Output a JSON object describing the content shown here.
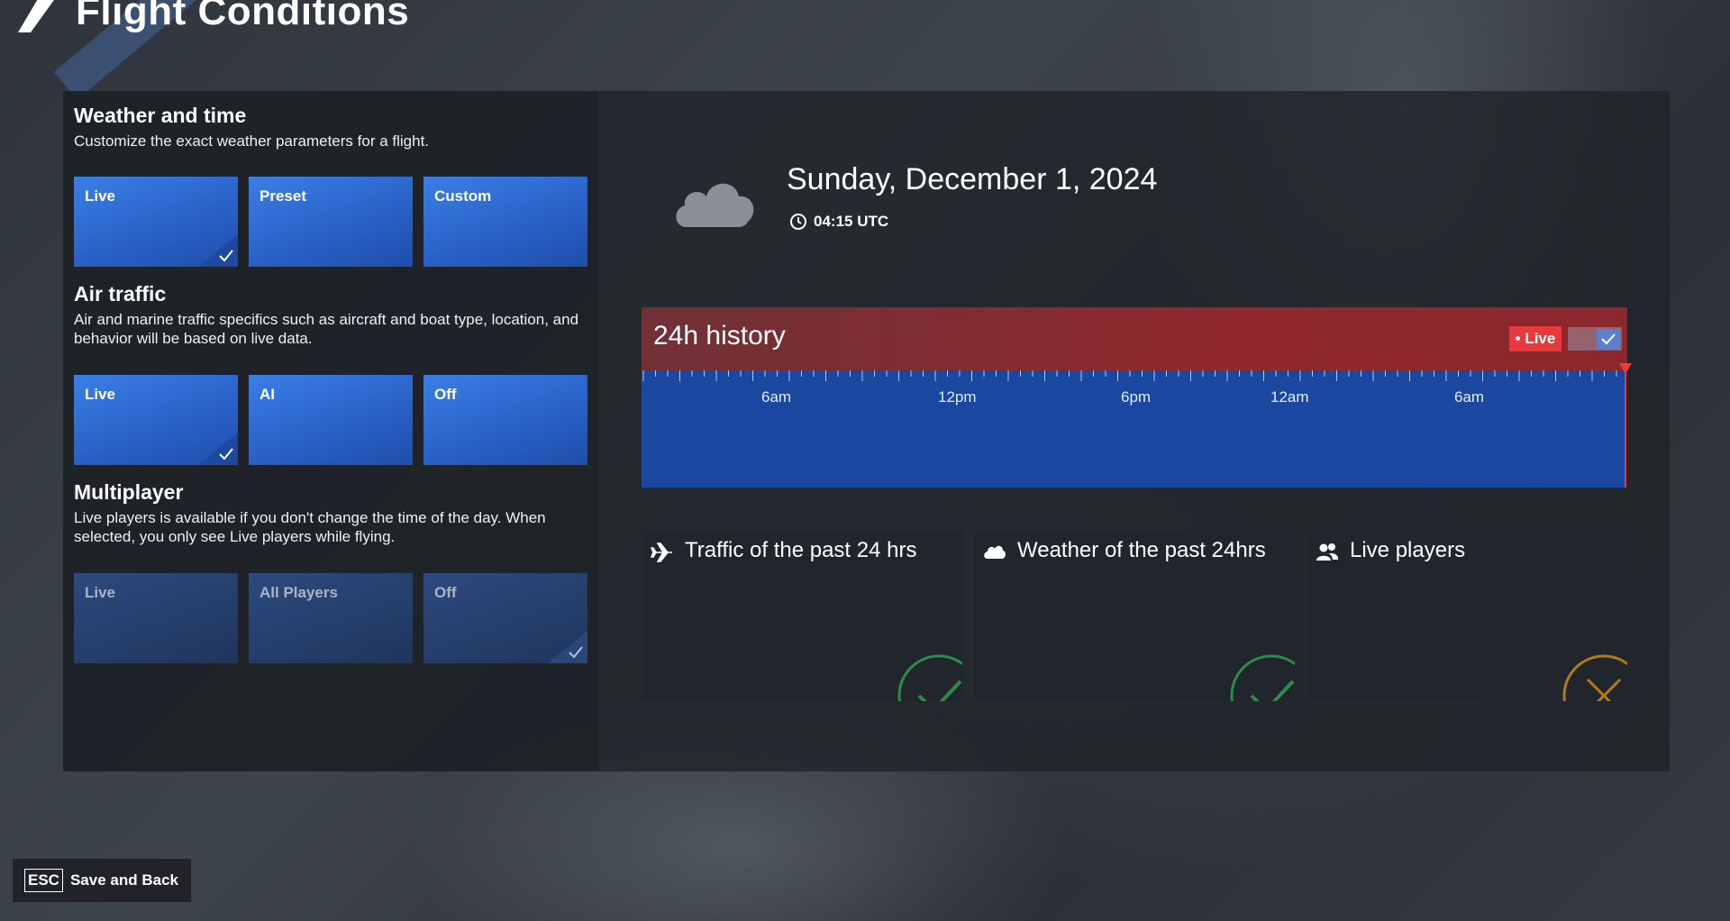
{
  "page": {
    "title": "Flight Conditions"
  },
  "weather_time": {
    "heading": "Weather and time",
    "description": "Customize the exact weather parameters for a flight.",
    "options": [
      {
        "label": "Live",
        "selected": true
      },
      {
        "label": "Preset",
        "selected": false
      },
      {
        "label": "Custom",
        "selected": false
      }
    ]
  },
  "air_traffic": {
    "heading": "Air traffic",
    "description": "Air and marine traffic specifics such as aircraft and boat type, location, and behavior will be based on live data.",
    "options": [
      {
        "label": "Live",
        "selected": true
      },
      {
        "label": "AI",
        "selected": false
      },
      {
        "label": "Off",
        "selected": false
      }
    ]
  },
  "multiplayer": {
    "heading": "Multiplayer",
    "description": "Live players is available if you don't change the time of the day. When selected, you only see Live players while flying.",
    "options": [
      {
        "label": "Live",
        "selected": false
      },
      {
        "label": "All Players",
        "selected": false
      },
      {
        "label": "Off",
        "selected": true
      }
    ]
  },
  "datetime": {
    "date": "Sunday, December 1, 2024",
    "time": "04:15 UTC",
    "weather_icon": "cloud-icon"
  },
  "history": {
    "title": "24h history",
    "live_badge": "• Live",
    "live_toggle_on": true,
    "timeline_labels": [
      "6am",
      "12pm",
      "6pm",
      "12am",
      "6am"
    ]
  },
  "status_cards": [
    {
      "title": "Traffic of the past 24 hrs",
      "icon": "airplane-icon",
      "status": "ok"
    },
    {
      "title": "Weather of the past 24hrs",
      "icon": "cloud-icon",
      "status": "ok"
    },
    {
      "title": "Live players",
      "icon": "players-icon",
      "status": "unavailable"
    }
  ],
  "footer": {
    "key": "ESC",
    "label": "Save and Back"
  },
  "colors": {
    "accent_blue": "#2a62c8",
    "live_red": "#e8393c",
    "ok_green": "#2e8b4a",
    "warn_amber": "#b07a1a"
  }
}
